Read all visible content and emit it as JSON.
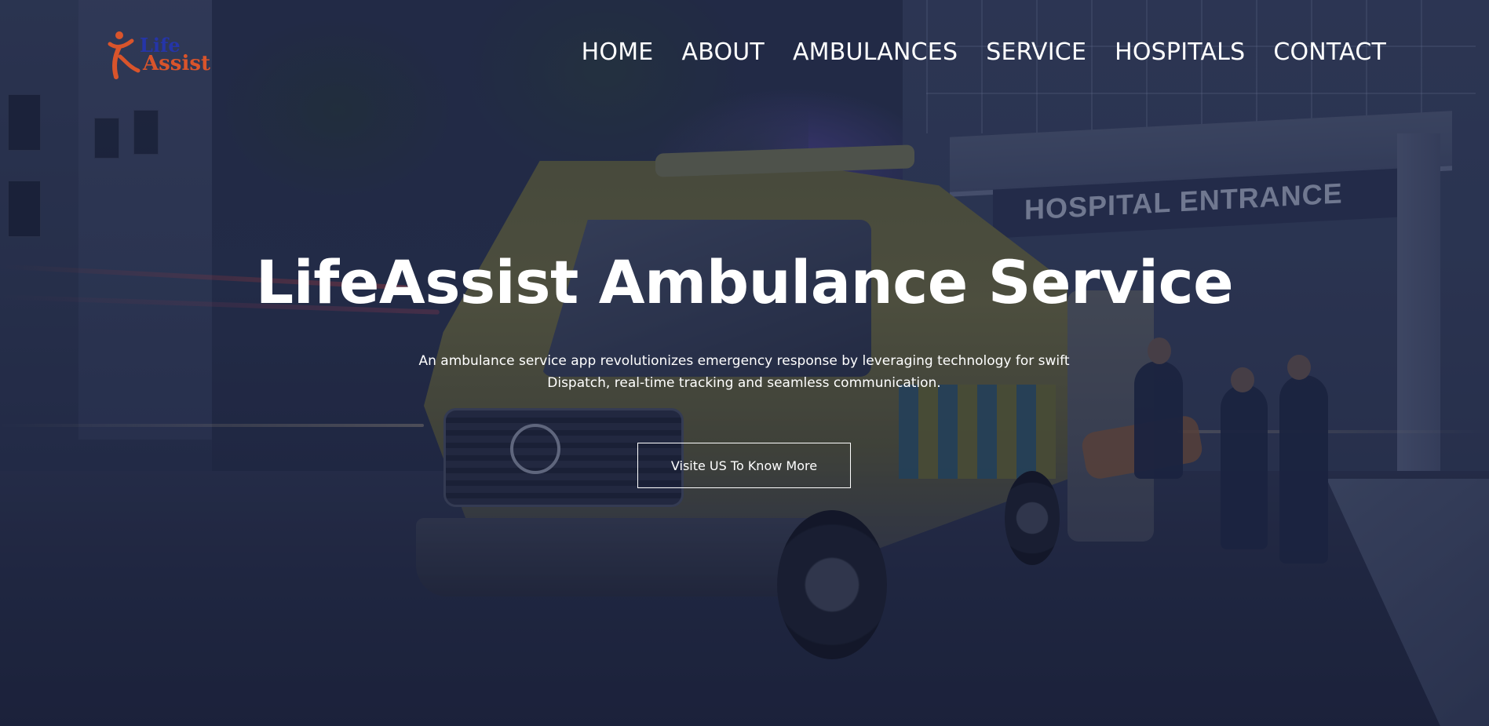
{
  "brand": {
    "logo_line1": "Life",
    "logo_line2": "Assist",
    "logo_icon": "runner-figure-icon",
    "colors": {
      "life": "#2535a8",
      "assist": "#d9542b"
    }
  },
  "nav": {
    "items": [
      {
        "label": "HOME"
      },
      {
        "label": "ABOUT"
      },
      {
        "label": "AMBULANCES"
      },
      {
        "label": "SERVICE"
      },
      {
        "label": "HOSPITALS"
      },
      {
        "label": "CONTACT"
      }
    ]
  },
  "hero": {
    "title": "LifeAssist Ambulance Service",
    "subtitle": "An ambulance service app revolutionizes emergency response by leveraging technology for swift Dispatch, real-time tracking and seamless communication.",
    "cta_label": "Visite US To Know More",
    "background_sign": "HOSPITAL ENTRANCE"
  }
}
